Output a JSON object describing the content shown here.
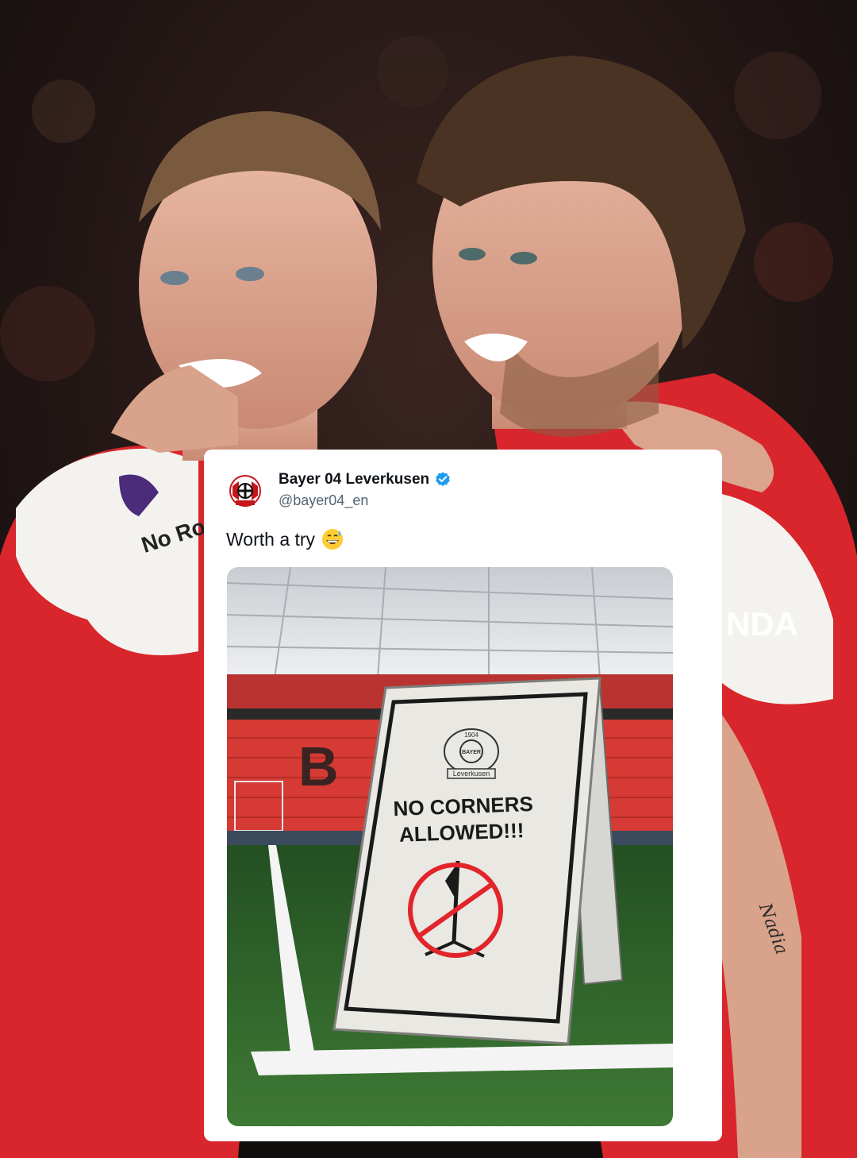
{
  "tweet": {
    "display_name": "Bayer 04 Leverkusen",
    "handle": "@bayer04_en",
    "text": "Worth a try",
    "emoji": "grinning-face-with-sweat-emoji",
    "verified_icon": "verified-badge-icon"
  },
  "sign": {
    "line1": "NO CORNERS",
    "line2": "ALLOWED!!!",
    "logo_text_top": "1904",
    "logo_text_mid": "BAYER",
    "logo_text_bottom": "Leverkusen",
    "pictogram": "no-corner-flag-icon"
  },
  "jersey_marks": {
    "sleeve_patch": "No Ro",
    "sponsor_fragment": "NDA",
    "tattoo": "Nadia"
  },
  "colors": {
    "jersey_red": "#d8262c",
    "twitter_blue": "#1d9bf0",
    "pitch_green": "#2f6a2a",
    "stand_red": "#d63a34"
  }
}
